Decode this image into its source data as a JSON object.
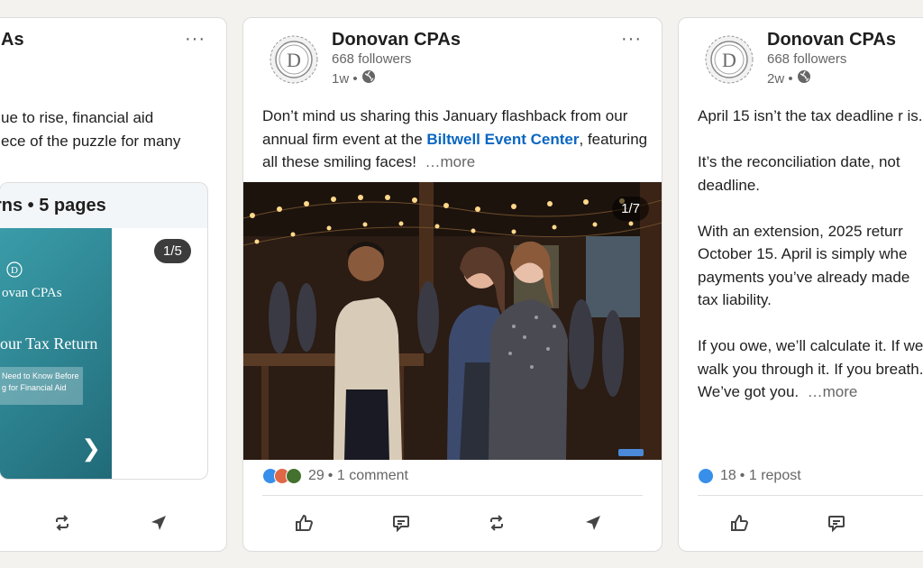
{
  "left_post": {
    "author_partial": "As",
    "body_lines": [
      "ue to rise, financial aid",
      "ece of the puzzle for many"
    ],
    "document_title": "rns • 5 pages",
    "page_counter": "1/5",
    "doc_logo": "ovan CPAs",
    "doc_heading": "our Tax Return",
    "doc_sub_lines": [
      "Need to Know Before",
      "g for Financial Aid"
    ],
    "doc_arrow": "❯",
    "more_menu": "···"
  },
  "middle_post": {
    "author": "Donovan CPAs",
    "followers": "668 followers",
    "age": "1w •",
    "more_menu": "···",
    "text_before_link": "Don’t mind us sharing this January flashback from our annual firm event at the ",
    "link_text": "Biltwell Event Center",
    "text_after_link": ", featuring all these smiling faces!",
    "see_more": "…more",
    "image_counter": "1/7",
    "reactions_count": "29",
    "comments": "• 1 comment"
  },
  "right_post": {
    "author": "Donovan CPAs",
    "followers": "668 followers",
    "age": "2w •",
    "paragraphs": [
      "April 15 isn’t the tax deadline r is.",
      "It’s the reconciliation date, not deadline.",
      "With an extension, 2025 returr October 15. April is simply whe payments you’ve already made tax liability."
    ],
    "last_paragraph": "If you owe, we’ll calculate it. If we’ll walk you through it. If you breath. We’ve got you.",
    "see_more": "…more",
    "reactions_count": "18",
    "reposts": "• 1 repost"
  },
  "colors": {
    "link": "#0a66c2",
    "like_blue": "#378fe9",
    "celebrate_orange": "#e06847",
    "support_green": "#44712e"
  },
  "icons": [
    "logo-icon",
    "globe-icon",
    "more-icon",
    "like-icon",
    "comment-icon",
    "repost-icon",
    "send-icon"
  ]
}
